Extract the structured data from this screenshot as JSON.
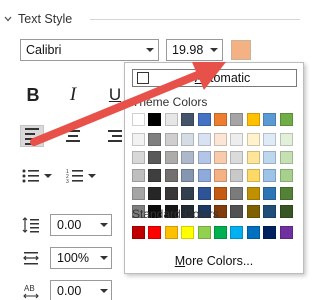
{
  "section": {
    "title": "Text Style"
  },
  "font": {
    "name": "Calibri",
    "size": "19.98"
  },
  "text_color": "#f4b183",
  "formatting": {
    "bold": "B",
    "italic": "I",
    "underline": "U"
  },
  "params": [
    {
      "icon": "line-spacing-icon",
      "value": "0.00"
    },
    {
      "icon": "character-width-icon",
      "value": "100%"
    },
    {
      "icon": "character-spacing-icon",
      "value": "0.00"
    }
  ],
  "color_picker": {
    "automatic": {
      "accel": "A",
      "rest": "utomatic"
    },
    "theme_label": "Theme Colors",
    "standard_label": "Standard Colors",
    "more": {
      "accel": "M",
      "rest": "ore Colors..."
    },
    "theme_colors": [
      [
        "#ffffff",
        "#000000",
        "#e7e6e6",
        "#44546a",
        "#4472c4",
        "#ed7d31",
        "#a5a5a5",
        "#ffc000",
        "#5b9bd5",
        "#70ad47"
      ],
      [
        "#f2f2f2",
        "#7f7f7f",
        "#d0cece",
        "#d6dce4",
        "#d9e2f3",
        "#fbe5d5",
        "#ededed",
        "#fff2cc",
        "#deebf6",
        "#e2efd9"
      ],
      [
        "#d8d8d8",
        "#595959",
        "#aeabab",
        "#adb9ca",
        "#b4c6e7",
        "#f7cbac",
        "#dbdbdb",
        "#fee599",
        "#bdd7ee",
        "#c5e0b3"
      ],
      [
        "#bfbfbf",
        "#3f3f3f",
        "#757070",
        "#8496b0",
        "#8eaadb",
        "#f4b183",
        "#c9c9c9",
        "#ffd965",
        "#9dc3e6",
        "#a8d08d"
      ],
      [
        "#a5a5a5",
        "#262626",
        "#3a3838",
        "#323f4f",
        "#2f5496",
        "#c55a11",
        "#7b7b7b",
        "#bf9000",
        "#2e75b5",
        "#538135"
      ],
      [
        "#7f7f7f",
        "#0c0c0c",
        "#171616",
        "#222a35",
        "#1e3864",
        "#833c0b",
        "#525252",
        "#7f6000",
        "#1f4e79",
        "#375623"
      ]
    ],
    "standard_colors": [
      "#c00000",
      "#ff0000",
      "#ffc000",
      "#ffff00",
      "#92d050",
      "#00b050",
      "#00b0f0",
      "#0070c0",
      "#002060",
      "#7030a0"
    ]
  }
}
